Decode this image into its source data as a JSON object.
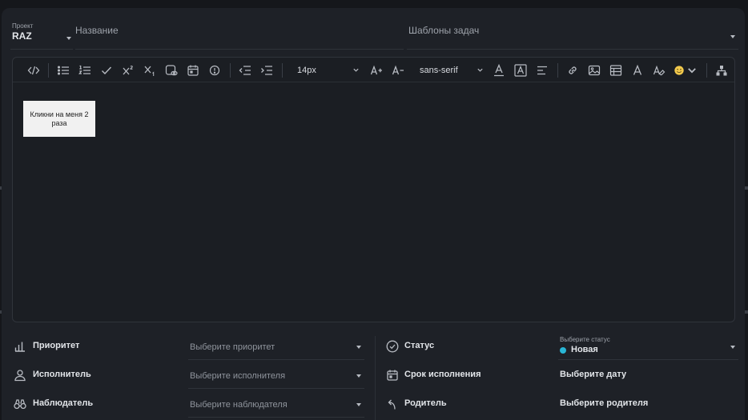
{
  "header": {
    "project_caption": "Проект",
    "project_value": "RAZ",
    "title_placeholder": "Название",
    "templates_label": "Шаблоны задач"
  },
  "toolbar": {
    "font_size": "14px",
    "font_family": "sans-serif",
    "icons": [
      "code-view-icon",
      "bullet-list-icon",
      "numbered-list-icon",
      "checklist-icon",
      "superscript-icon",
      "subscript-icon",
      "preview-icon",
      "calendar-icon",
      "info-icon",
      "outdent-icon",
      "indent-icon",
      "increase-font-icon",
      "decrease-font-icon",
      "text-color-icon",
      "background-color-icon",
      "align-icon",
      "link-icon",
      "image-icon",
      "table-icon",
      "font-icon",
      "clear-format-icon",
      "emoji-icon",
      "hierarchy-icon"
    ]
  },
  "editor": {
    "button_text": "Кликни на меня 2 раза"
  },
  "fields": {
    "priority": {
      "label": "Приоритет",
      "placeholder": "Выберите приоритет"
    },
    "assignee": {
      "label": "Исполнитель",
      "placeholder": "Выберите исполнителя"
    },
    "watcher": {
      "label": "Наблюдатель",
      "placeholder": "Выберите наблюдателя"
    },
    "status": {
      "label": "Статус",
      "caption": "Выберите статус",
      "value": "Новая",
      "color": "#29b6d6"
    },
    "due_date": {
      "label": "Срок исполнения",
      "value": "Выберите дату"
    },
    "parent": {
      "label": "Родитель",
      "value": "Выберите родителя"
    }
  },
  "colors": {
    "background": "#15171b",
    "panel": "#1e2127",
    "accent": "#29b6d6"
  }
}
